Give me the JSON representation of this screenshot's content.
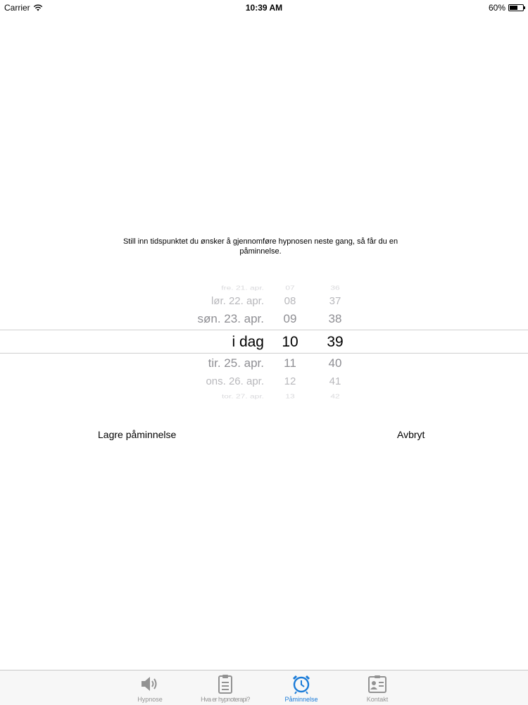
{
  "status_bar": {
    "carrier": "Carrier",
    "time": "10:39 AM",
    "battery_percent": "60%",
    "battery_level": 0.6
  },
  "instructions": "Still inn tidspunktet du ønsker å gjennomføre hypnosen neste gang, så får du en påminnelse.",
  "picker": {
    "rows": [
      {
        "day": "fre. 21. apr.",
        "hour": "07",
        "minute": "36"
      },
      {
        "day": "lør. 22. apr.",
        "hour": "08",
        "minute": "37"
      },
      {
        "day": "søn. 23. apr.",
        "hour": "09",
        "minute": "38"
      },
      {
        "day": "i dag",
        "hour": "10",
        "minute": "39"
      },
      {
        "day": "tir. 25. apr.",
        "hour": "11",
        "minute": "40"
      },
      {
        "day": "ons. 26. apr.",
        "hour": "12",
        "minute": "41"
      },
      {
        "day": "tor. 27. apr.",
        "hour": "13",
        "minute": "42"
      }
    ],
    "selected_index": 3
  },
  "actions": {
    "save_label": "Lagre påminnelse",
    "cancel_label": "Avbryt"
  },
  "tab_bar": {
    "tabs": [
      {
        "label": "Hypnose",
        "icon": "speaker-icon",
        "active": false
      },
      {
        "label": "Hva er hypnoterapi?",
        "icon": "clipboard-icon",
        "active": false
      },
      {
        "label": "Påminnelse",
        "icon": "alarm-clock-icon",
        "active": true
      },
      {
        "label": "Kontakt",
        "icon": "contact-card-icon",
        "active": false
      }
    ]
  },
  "colors": {
    "accent": "#1a7bd8",
    "inactive_tab": "#929292"
  }
}
